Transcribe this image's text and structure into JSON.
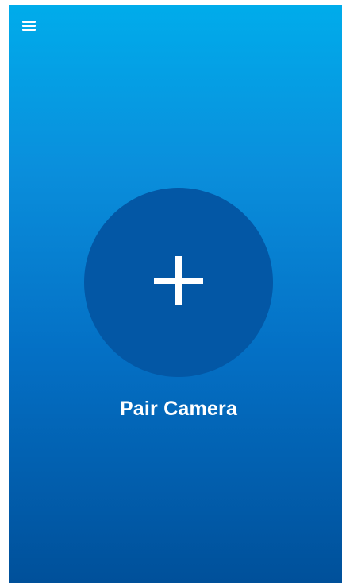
{
  "header": {
    "menu_icon": "hamburger-menu-icon"
  },
  "main": {
    "pair_icon": "plus-icon",
    "pair_label": "Pair Camera"
  },
  "colors": {
    "gradient_top": "#00aceb",
    "gradient_bottom": "#00509a",
    "circle": "#0357a5",
    "foreground": "#ffffff"
  }
}
